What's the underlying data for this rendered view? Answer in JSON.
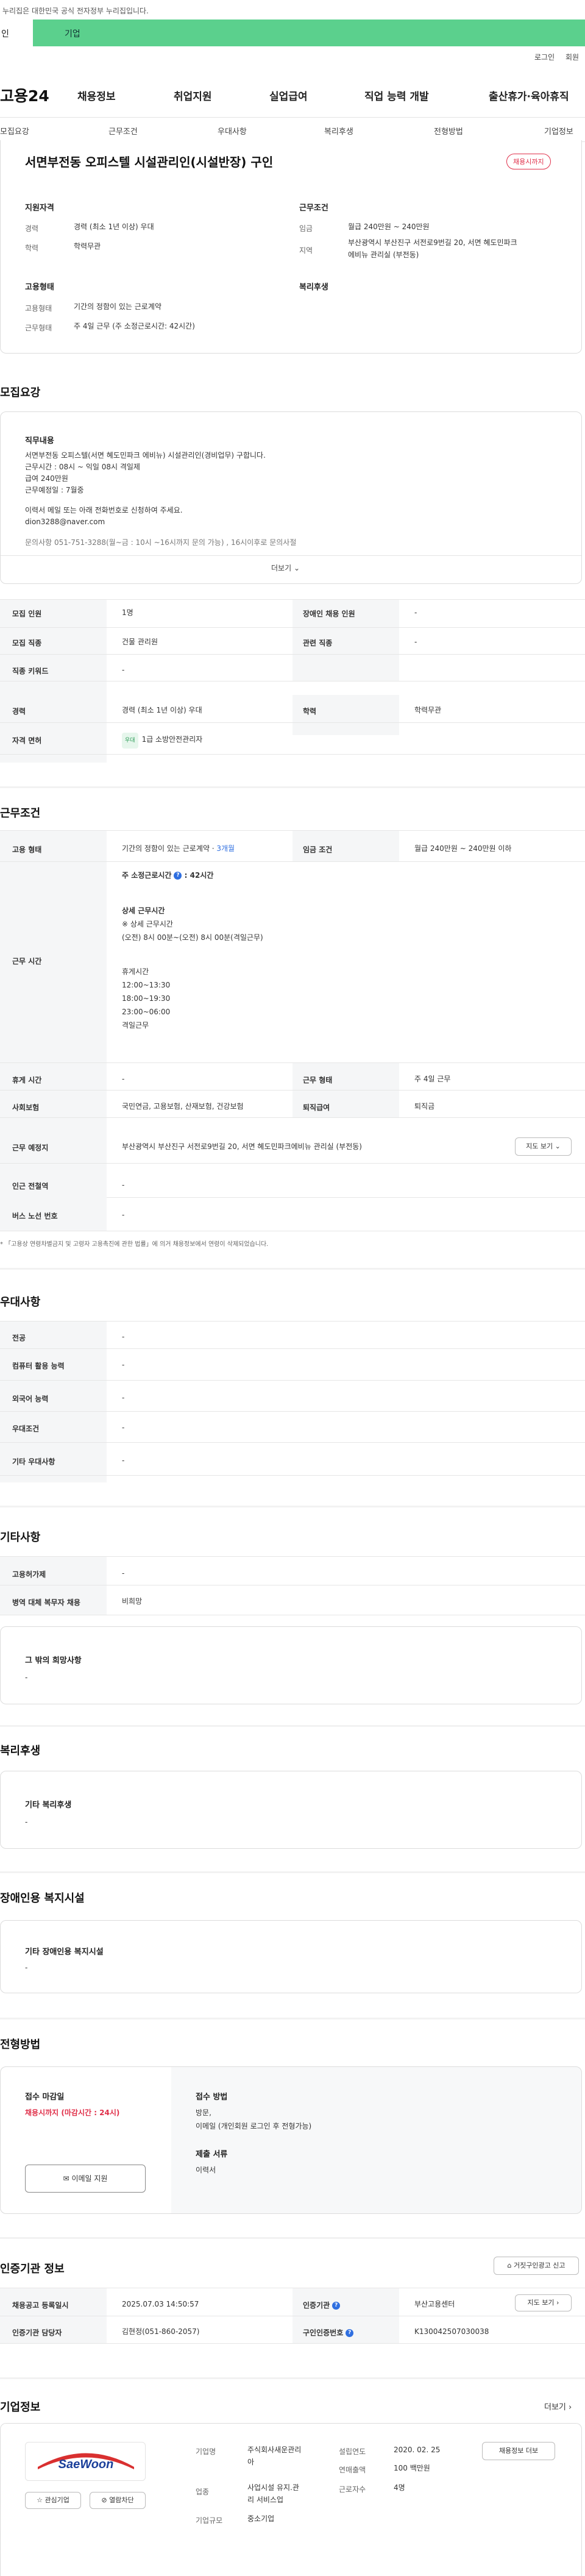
{
  "gov_notice": "누리집은 대한민국 공식 전자정부 누리집입니다.",
  "top_tabs": {
    "personal": "인",
    "company": "기업"
  },
  "util": {
    "login": "로그인",
    "join": "회원"
  },
  "logo": "고용24",
  "gnb": [
    "채용정보",
    "취업지원",
    "실업급여",
    "직업 능력 개발",
    "출산휴가·육아휴직"
  ],
  "snb": [
    "모집요강",
    "근무조건",
    "우대사항",
    "복리후생",
    "전형방법",
    "기업정보"
  ],
  "summary": {
    "title": "서면부전동 오피스텔 시설관리인(시설반장) 구인",
    "badge": "채용시까지",
    "qual_title": "지원자격",
    "cond_title": "근무조건",
    "career_label": "경력",
    "career_value": "경력 (최소 1년 이상) 우대",
    "edu_label": "학력",
    "edu_value": "학력무관",
    "wage_label": "임금",
    "wage_value": "월급 240만원 ~ 240만원",
    "region_label": "지역",
    "region_value1": "부산광역시 부산진구 서전로9번길 20, 서면 혜도민파크",
    "region_value2": "에비뉴 관리실 (부전동)",
    "emp_title": "고용형태",
    "welfare_title": "복리후생",
    "emptype_label": "고용형태",
    "emptype_value": "기간의 정함이 있는 근로계약",
    "worktype_label": "근무형태",
    "worktype_value": "주 4일 근무 (주 소정근로시간: 42시간)"
  },
  "recruit": {
    "section": "모집요강",
    "duty_title": "직무내용",
    "duty_lines": [
      "서면부전동 오피스텔(서면 혜도민파크 에비뉴) 시설관리인(경비업무) 구합니다.",
      "근무시간 : 08시 ~ 익일 08시   격일제",
      "급여 240만원",
      "근무예정일 : 7월중",
      "",
      "이력서 메일 또는 아래 전화번호로 신청하여 주세요.",
      "dion3288@naver.com",
      "",
      "문의사항 051-751-3288(월~금 : 10시 ~16시까지 문의 가능) , 16시이후로 문의사절"
    ],
    "more": "더보기",
    "rows": [
      {
        "h1": "모집 인원",
        "v1": "1명",
        "h2": "장애인 채용 인원",
        "v2": "-"
      },
      {
        "h1": "모집 직종",
        "v1": "건물 관리원",
        "h2": "관련 직종",
        "v2": "-"
      },
      {
        "h1": "직종 키워드",
        "v1": "-",
        "h2": "",
        "v2": ""
      },
      {
        "h1": "경력",
        "v1": "경력 (최소 1년 이상) 우대",
        "h2": "학력",
        "v2": "학력무관"
      }
    ],
    "license_h": "자격 면허",
    "license_tag": "우대",
    "license_v": "1급 소방안전관리자"
  },
  "workcond": {
    "section": "근무조건",
    "emptype_h": "고용 형태",
    "emptype_v": "기간의 정함이 있는 근로계약 · ",
    "emptype_link": "3개월",
    "wage_h": "임금 조건",
    "wage_v": "월급 240만원 ~ 240만원 이하",
    "hours_h": "근무 시간",
    "hours_title": "주 소정근로시간",
    "hours_title_tail": ": 42시간",
    "hours_lines": [
      "상세 근무시간",
      "※ 상세 근무시간",
      "(오전) 8시 00분~(오전) 8시 00분(격일근무)",
      "",
      "휴게시간",
      "12:00~13:30",
      "18:00~19:30",
      "23:00~06:00",
      "격일근무"
    ],
    "rest_h": "휴게 시간",
    "rest_v": "-",
    "shift_h": "근무 형태",
    "shift_v": "주 4일 근무",
    "ins_h": "사회보험",
    "ins_v": "국민연금, 고용보험, 산재보험, 건강보험",
    "ret_h": "퇴직급여",
    "ret_v": "퇴직금",
    "place_h": "근무 예정지",
    "place_v": "부산광역시 부산진구 서전로9번길 20, 서면 혜도민파크에비뉴 관리실 (부전동)",
    "map_btn": "지도 보기",
    "subway_h": "인근 전철역",
    "subway_v": "-",
    "bus_h": "버스 노선 번호",
    "bus_v": "-",
    "note": "* 「고용상 연령차별금지 및 고령자 고용촉진에 관한 법률」에 의거 채용정보에서 연령이 삭제되었습니다."
  },
  "pref": {
    "section": "우대사항",
    "rows": [
      {
        "h": "전공",
        "v": "-"
      },
      {
        "h": "컴퓨터 활용 능력",
        "v": "-"
      },
      {
        "h": "외국어 능력",
        "v": "-"
      },
      {
        "h": "우대조건",
        "v": "-"
      },
      {
        "h": "기타 우대사항",
        "v": "-"
      }
    ]
  },
  "etc": {
    "section": "기타사항",
    "rows": [
      {
        "h": "고용허가제",
        "v": "-"
      },
      {
        "h": "병역 대체 복무자 채용",
        "v": "비희망"
      }
    ],
    "other_title": "그 밖의 희망사항",
    "other_v": "-"
  },
  "welfare": {
    "section": "복리후생",
    "title": "기타 복리후생",
    "v": "-"
  },
  "disabled": {
    "section": "장애인용 복지시설",
    "title": "기타 장애인용 복지시설",
    "v": "-"
  },
  "selection": {
    "section": "전형방법",
    "deadline_title": "접수 마감일",
    "deadline_v": "채용시까지 (마감시간 : 24시)",
    "method_title": "접수 방법",
    "method_v1": "방문,",
    "method_v2": "이메일 (개인회원 로그인 후 전형가능)",
    "doc_title": "제출 서류",
    "doc_v": "이력서",
    "apply_btn": "이메일 지원"
  },
  "auth": {
    "section": "인증기관 정보",
    "report_btn": "거짓구인광고 신고",
    "reg_h": "채용공고 등록일시",
    "reg_v": "2025.07.03 14:50:57",
    "org_h": "인증기관",
    "org_v": "부산고용센터",
    "map_btn": "지도 보기",
    "mgr_h": "인증기관 담당자",
    "mgr_v": "김현정(051-860-2057)",
    "no_h": "구인인증번호",
    "no_v": "K130042507030038"
  },
  "company": {
    "section": "기업정보",
    "more": "더보기",
    "logo_text": "SaeWoon",
    "fav_btn": "관심기업",
    "block_btn": "열람차단",
    "name_h": "기업명",
    "name_v1": "주식회사새운관리",
    "name_v2": "아",
    "est_h": "설립연도",
    "est_v": "2020. 02. 25",
    "sales_h": "연매출액",
    "sales_v": "100 백만원",
    "ind_h": "업종",
    "ind_v1": "사업시설 유지.관",
    "ind_v2": "리 서비스업",
    "emp_h": "근로자수",
    "emp_v": "4명",
    "size_h": "기업규모",
    "size_v": "중소기업",
    "jobs_btn": "채용정보 더보"
  }
}
